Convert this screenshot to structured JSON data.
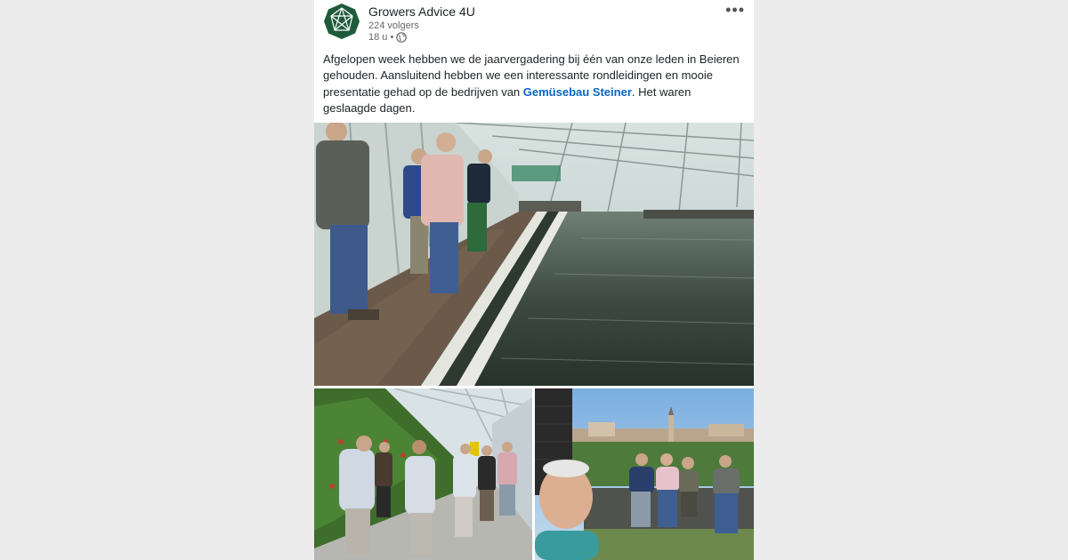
{
  "post": {
    "author": "Growers Advice 4U",
    "followers": "224 volgers",
    "time": "18 u •",
    "more_icon": "more-horizontal-icon",
    "visibility_icon": "globe-icon",
    "text_part1": "Afgelopen week hebben we de jaarvergadering bij één van onze leden in Beieren gehouden. Aansluitend hebben we een interessante rondleidingen en mooie presentatie gehad op de bedrijven van ",
    "link": "Gemüsebau Steiner",
    "text_part2": ". Het waren geslaagde dagen."
  },
  "colors": {
    "brand": "#1f5a3a",
    "link": "#0a66c2"
  }
}
